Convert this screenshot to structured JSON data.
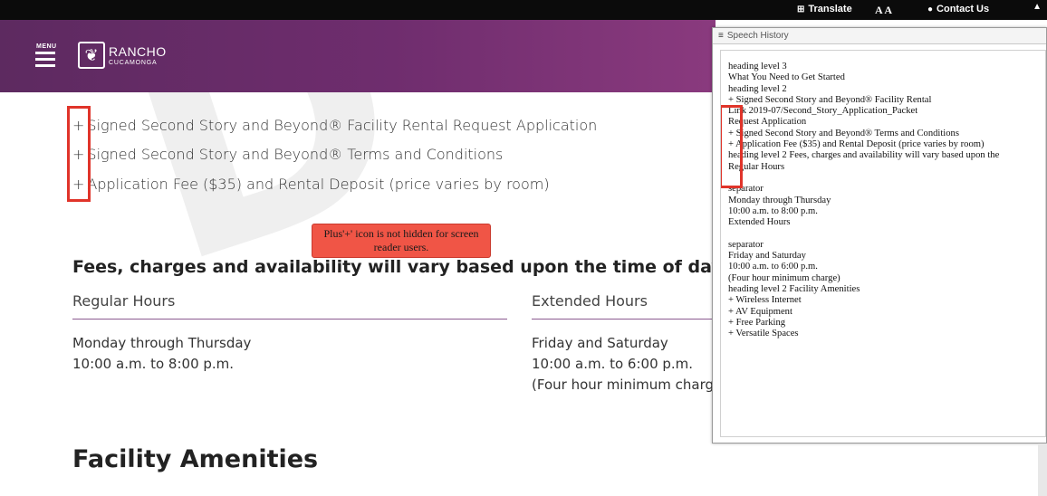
{
  "utility": {
    "translate": "Translate",
    "text_size": "A A",
    "contact": "Contact Us"
  },
  "header": {
    "menu_label": "MENU",
    "logo_line1": "RANCHO",
    "logo_line2": "CUCAMONGA"
  },
  "watermark": "D",
  "requirements": [
    "Signed Second Story and Beyond® Facility Rental Request Application",
    "Signed Second Story and Beyond® Terms and Conditions",
    "Application Fee ($35) and Rental Deposit (price varies by room)"
  ],
  "plus_glyph": "+",
  "callout": "Plus'+' icon is not hidden for screen reader users.",
  "fees_heading": "Fees, charges and availability will vary based upon the time of day use",
  "regular": {
    "heading": "Regular Hours",
    "line1": "Monday through Thursday",
    "line2": "10:00 a.m. to 8:00 p.m."
  },
  "extended": {
    "heading": "Extended Hours",
    "line1": "Friday and Saturday",
    "line2": "10:00 a.m. to 6:00 p.m.",
    "line3": "(Four hour minimum charge)"
  },
  "amenities_heading": "Facility Amenities",
  "speech_history": {
    "title": "Speech History",
    "lines": [
      "heading level 3",
      "What You Need to Get Started",
      "heading level 2",
      "+ Signed Second Story and Beyond® Facility Rental",
      "Link 2019-07/Second_Story_Application_Packet",
      "Request Application",
      "+ Signed Second Story and Beyond® Terms and Conditions",
      "+ Application Fee ($35) and Rental Deposit (price varies by room)",
      "heading level 2 Fees, charges and availability will vary based upon the",
      "Regular Hours",
      "",
      "separator",
      "Monday through Thursday",
      "10:00 a.m. to 8:00 p.m.",
      "Extended Hours",
      "",
      "separator",
      "Friday and Saturday",
      "10:00 a.m. to 6:00 p.m.",
      "(Four hour minimum charge)",
      "heading level 2 Facility Amenities",
      "+ Wireless Internet",
      "+ AV Equipment",
      "+ Free Parking",
      "+ Versatile Spaces"
    ]
  },
  "colors": {
    "header_purple": "#6f2d6e",
    "highlight_red": "#e0342a",
    "callout_red": "#f05546"
  }
}
